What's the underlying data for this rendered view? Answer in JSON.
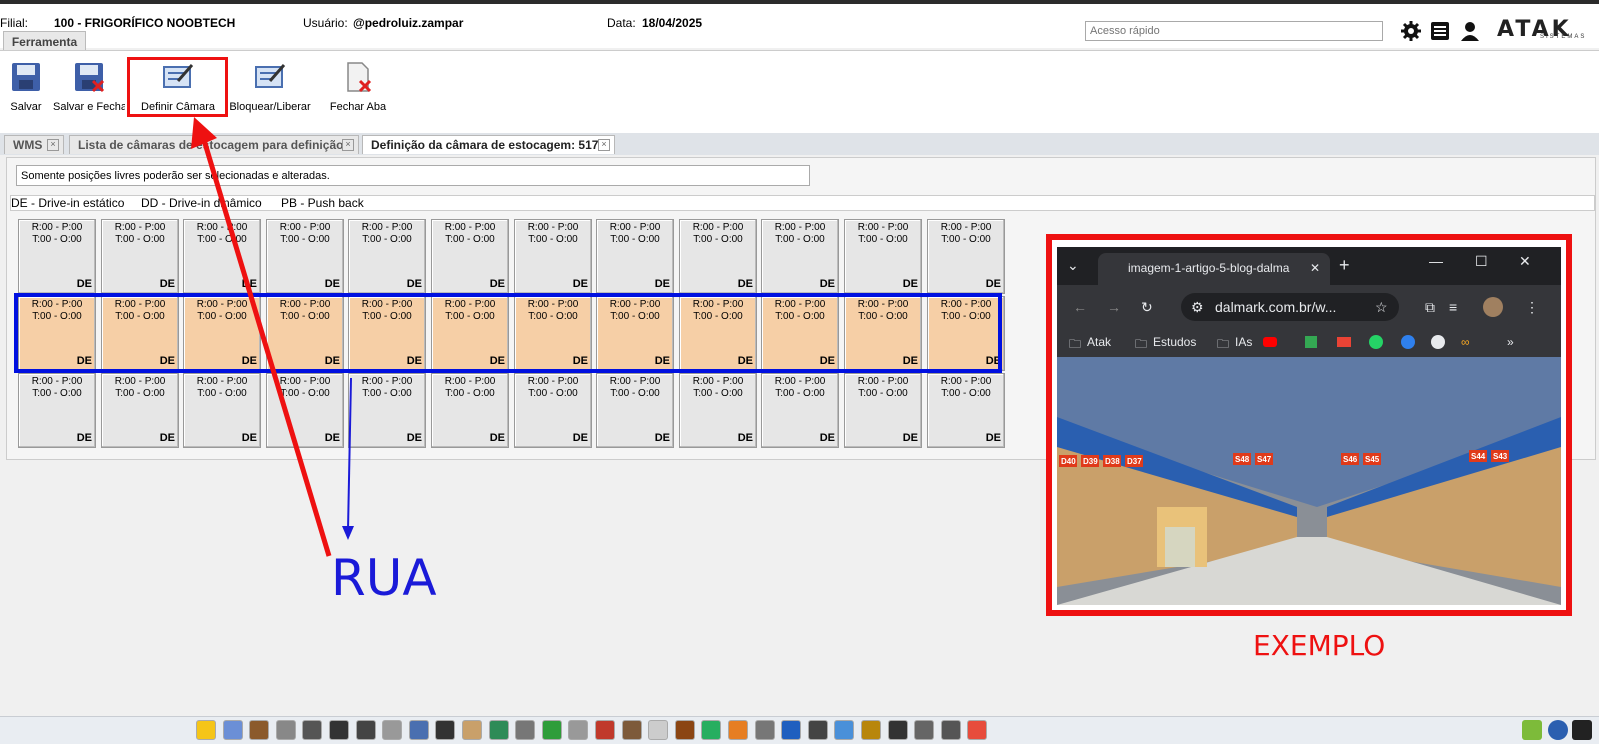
{
  "header": {
    "filial_label": "Filial:",
    "filial_value": "100 - FRIGORÍFICO NOOBTECH",
    "usuario_label": "Usuário:",
    "usuario_value": "@pedroluiz.zampar",
    "data_label": "Data:",
    "data_value": "18/04/2025",
    "quick_access_placeholder": "Acesso rápido",
    "logo_text": "ATAK",
    "logo_sub": "SISTEMAS"
  },
  "ribbon": {
    "tab_label": "Ferramenta",
    "buttons": {
      "save": "Salvar",
      "save_close": "Salvar e Fechar",
      "define_chamber": "Definir Câmara",
      "block_release": "Bloquear/Liberar",
      "close_tab": "Fechar Aba"
    }
  },
  "doc_tabs": [
    {
      "label": "WMS"
    },
    {
      "label": "Lista de câmaras de estocagem para definição"
    },
    {
      "label": "Definição da câmara de estocagem: 517"
    }
  ],
  "content": {
    "message": "Somente posições livres poderão ser selecionadas e alteradas.",
    "legend": {
      "de": "DE - Drive-in estático",
      "dd": "DD - Drive-in dinâmico",
      "pb": "PB - Push back"
    },
    "cell": {
      "line1": "R:00 - P:00",
      "line2": "T:00 - O:00",
      "tag": "DE"
    },
    "grid_rows": 3,
    "grid_cols": 12,
    "highlighted_row": 2
  },
  "annotations": {
    "rua": "RUA",
    "exemplo": "EXEMPLO",
    "colors": {
      "red": "#ee1111",
      "blue": "#0010e0",
      "orange_cell": "#f6cfa6"
    }
  },
  "browser": {
    "tab_title": "imagem-1-artigo-5-blog-dalma",
    "url": "dalmark.com.br/w...",
    "bookmarks": [
      "Atak",
      "Estudos",
      "IAs"
    ],
    "rack_labels": [
      "D40",
      "D39",
      "D38",
      "D37",
      "S48",
      "S47",
      "S46",
      "S45",
      "S44",
      "S43"
    ]
  },
  "taskbar": {
    "icons": [
      "star-icon",
      "user-icon",
      "briefcase-icon",
      "calculator-icon",
      "barcode-icon",
      "flag-icon",
      "warning-icon",
      "tag-icon",
      "document-icon",
      "book-icon",
      "pallet-icon",
      "globe-icon",
      "barrel-icon",
      "money-icon",
      "printer-icon",
      "factory-icon",
      "warehouse-icon",
      "bottle-icon",
      "truck-icon",
      "chart-icon",
      "receipt-icon",
      "table-icon",
      "diamond-icon",
      "tools-icon",
      "calendar-icon",
      "box-icon",
      "cart-icon",
      "network-icon",
      "headset-icon",
      "puzzle-icon"
    ]
  }
}
